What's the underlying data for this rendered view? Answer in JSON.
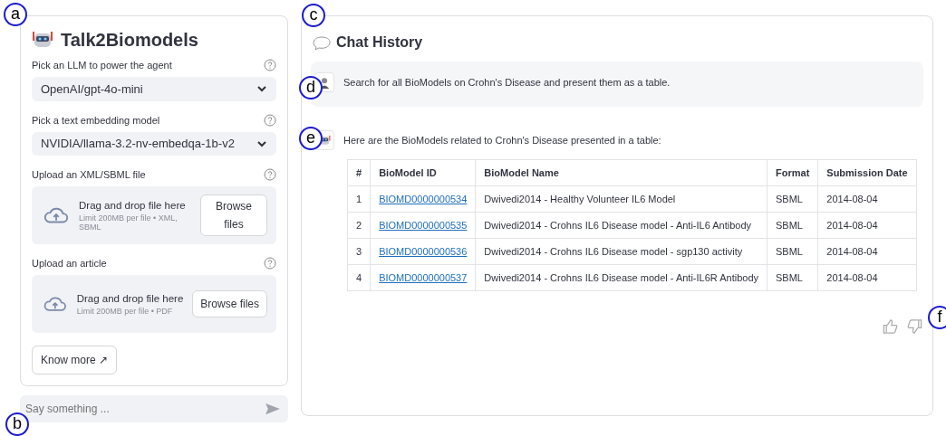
{
  "sidebar": {
    "title": "Talk2Biomodels",
    "fields": [
      {
        "kind": "select",
        "label": "Pick an LLM to power the agent",
        "value": "OpenAI/gpt-4o-mini"
      },
      {
        "kind": "select",
        "label": "Pick a text embedding model",
        "value": "NVIDIA/llama-3.2-nv-embedqa-1b-v2"
      },
      {
        "kind": "upload",
        "label": "Upload an XML/SBML file",
        "drop_text": "Drag and drop file here",
        "limit": "Limit 200MB per file • XML, SBML",
        "button": "Browse files",
        "narrow": true
      },
      {
        "kind": "upload",
        "label": "Upload an article",
        "drop_text": "Drag and drop file here",
        "limit": "Limit 200MB per file • PDF",
        "button": "Browse files",
        "narrow": false
      }
    ],
    "link_button": "Know more ↗"
  },
  "chat_input": {
    "placeholder": "Say something ..."
  },
  "chat": {
    "title": "Chat History",
    "messages": [
      {
        "kind": "user",
        "text": "Search for all BioModels on Crohn's Disease and present them as a table."
      },
      {
        "kind": "assistant",
        "text": "Here are the BioModels related to Crohn's Disease presented in a table:",
        "table": {
          "columns": [
            "#",
            "BioModel ID",
            "BioModel Name",
            "Format",
            "Submission Date"
          ],
          "rows": [
            [
              "1",
              "BIOMD0000000534",
              "Dwivedi2014 - Healthy Volunteer IL6 Model",
              "SBML",
              "2014-08-04"
            ],
            [
              "2",
              "BIOMD0000000535",
              "Dwivedi2014 - Crohns IL6 Disease model - Anti-IL6 Antibody",
              "SBML",
              "2014-08-04"
            ],
            [
              "3",
              "BIOMD0000000536",
              "Dwivedi2014 - Crohns IL6 Disease model - sgp130 activity",
              "SBML",
              "2014-08-04"
            ],
            [
              "4",
              "BIOMD0000000537",
              "Dwivedi2014 - Crohns IL6 Disease model - Anti-IL6R Antibody",
              "SBML",
              "2014-08-04"
            ]
          ]
        }
      }
    ]
  },
  "callouts": [
    {
      "label": "a",
      "kind": "sidebar"
    },
    {
      "label": "b",
      "kind": "input"
    },
    {
      "label": "c",
      "kind": "chat"
    },
    {
      "label": "d",
      "kind": "user"
    },
    {
      "label": "e",
      "kind": "assistant"
    },
    {
      "label": "f",
      "kind": "feedback"
    }
  ]
}
